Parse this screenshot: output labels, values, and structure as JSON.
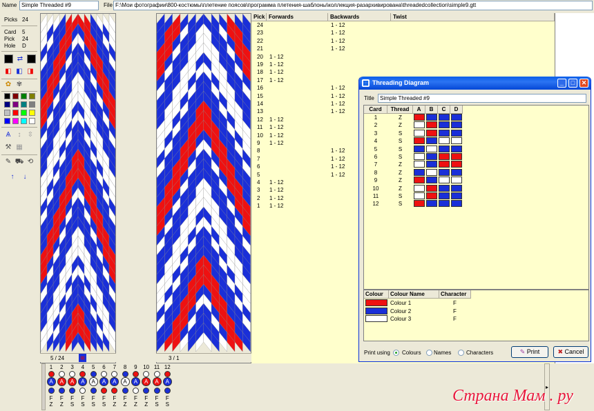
{
  "toolbar": {
    "name_label": "Name",
    "name_value": "Simple Threaded #9",
    "file_label": "File",
    "file_path": "F:\\Мои фотографии\\800-костюмы\\плетение поясов\\программа плетения-шаблоны\\коллекция-разархивирована\\threadedcollection\\simple9.gtt"
  },
  "info": {
    "picks_label": "Picks",
    "picks_value": "24",
    "card_label": "Card",
    "card_value": "5",
    "pick_label": "Pick",
    "pick_value": "24",
    "hole_label": "Hole",
    "hole_value": "D"
  },
  "palette": [
    "#000000",
    "#800000",
    "#008000",
    "#808000",
    "#000080",
    "#800080",
    "#008080",
    "#808080",
    "#C0C0C0",
    "#FF0000",
    "#00FF00",
    "#FFFF00",
    "#0000FF",
    "#FF00FF",
    "#00FFFF",
    "#FFFFFF"
  ],
  "colors": {
    "red": "#EE1111",
    "blue": "#1A2FD8",
    "white": "#FFFFFF",
    "pale_yellow": "#FFFFCC"
  },
  "status": {
    "left_counter": "5 / 24",
    "right_counter": "3 / 1"
  },
  "pick_table": {
    "headers": {
      "pick": "Pick",
      "forwards": "Forwards",
      "backwards": "Backwards",
      "twist": "Twist"
    },
    "rows": [
      {
        "pick": "24",
        "f": "",
        "b": "1 - 12"
      },
      {
        "pick": "23",
        "f": "",
        "b": "1 - 12"
      },
      {
        "pick": "22",
        "f": "",
        "b": "1 - 12"
      },
      {
        "pick": "21",
        "f": "",
        "b": "1 - 12"
      },
      {
        "pick": "20",
        "f": "1 - 12",
        "b": ""
      },
      {
        "pick": "19",
        "f": "1 - 12",
        "b": ""
      },
      {
        "pick": "18",
        "f": "1 - 12",
        "b": ""
      },
      {
        "pick": "17",
        "f": "1 - 12",
        "b": ""
      },
      {
        "pick": "16",
        "f": "",
        "b": "1 - 12"
      },
      {
        "pick": "15",
        "f": "",
        "b": "1 - 12"
      },
      {
        "pick": "14",
        "f": "",
        "b": "1 - 12"
      },
      {
        "pick": "13",
        "f": "",
        "b": "1 - 12"
      },
      {
        "pick": "12",
        "f": "1 - 12",
        "b": ""
      },
      {
        "pick": "11",
        "f": "1 - 12",
        "b": ""
      },
      {
        "pick": "10",
        "f": "1 - 12",
        "b": ""
      },
      {
        "pick": "9",
        "f": "1 - 12",
        "b": ""
      },
      {
        "pick": "8",
        "f": "",
        "b": "1 - 12"
      },
      {
        "pick": "7",
        "f": "",
        "b": "1 - 12"
      },
      {
        "pick": "6",
        "f": "",
        "b": "1 - 12"
      },
      {
        "pick": "5",
        "f": "",
        "b": "1 - 12"
      },
      {
        "pick": "4",
        "f": "1 - 12",
        "b": ""
      },
      {
        "pick": "3",
        "f": "1 - 12",
        "b": ""
      },
      {
        "pick": "2",
        "f": "1 - 12",
        "b": ""
      },
      {
        "pick": "1",
        "f": "1 - 12",
        "b": ""
      }
    ]
  },
  "dialog": {
    "title": "Threading Diagram",
    "title_label": "Title",
    "title_value": "Simple Threaded #9",
    "headers": {
      "card": "Card",
      "thread": "Thread",
      "a": "A",
      "b": "B",
      "c": "C",
      "d": "D"
    },
    "cards": [
      {
        "card": "1",
        "thread": "Z",
        "holes": [
          "R",
          "B",
          "B",
          "B"
        ]
      },
      {
        "card": "2",
        "thread": "Z",
        "holes": [
          "W",
          "R",
          "B",
          "B"
        ]
      },
      {
        "card": "3",
        "thread": "S",
        "holes": [
          "W",
          "R",
          "B",
          "B"
        ]
      },
      {
        "card": "4",
        "thread": "S",
        "holes": [
          "R",
          "B",
          "W",
          "W"
        ]
      },
      {
        "card": "5",
        "thread": "S",
        "holes": [
          "B",
          "W",
          "B",
          "B"
        ]
      },
      {
        "card": "6",
        "thread": "S",
        "holes": [
          "W",
          "B",
          "R",
          "R"
        ]
      },
      {
        "card": "7",
        "thread": "Z",
        "holes": [
          "W",
          "B",
          "R",
          "R"
        ]
      },
      {
        "card": "8",
        "thread": "Z",
        "holes": [
          "B",
          "W",
          "B",
          "B"
        ]
      },
      {
        "card": "9",
        "thread": "Z",
        "holes": [
          "R",
          "B",
          "W",
          "W"
        ]
      },
      {
        "card": "10",
        "thread": "Z",
        "holes": [
          "W",
          "R",
          "B",
          "B"
        ]
      },
      {
        "card": "11",
        "thread": "S",
        "holes": [
          "W",
          "R",
          "B",
          "B"
        ]
      },
      {
        "card": "12",
        "thread": "S",
        "holes": [
          "R",
          "B",
          "B",
          "B"
        ]
      }
    ],
    "legend_headers": {
      "colour": "Colour",
      "name": "Colour Name",
      "character": "Character"
    },
    "legend": [
      {
        "name": "Colour 1",
        "char": "F",
        "color": "#EE1111"
      },
      {
        "name": "Colour 2",
        "char": "F",
        "color": "#1A2FD8"
      },
      {
        "name": "Colour 3",
        "char": "F",
        "color": "#FFFFFF"
      }
    ],
    "print_using": "Print using",
    "options": [
      "Colours",
      "Names",
      "Characters"
    ],
    "selected_option": "Colours",
    "print_button": "Print",
    "cancel_button": "Cancel"
  },
  "bottom": {
    "card_numbers": [
      "1",
      "2",
      "3",
      "4",
      "5",
      "6",
      "7",
      "8",
      "9",
      "10",
      "11",
      "12"
    ],
    "center_letters": [
      "A",
      "A",
      "A",
      "A",
      "A",
      "A",
      "A",
      "A",
      "A",
      "A",
      "A",
      "A"
    ],
    "f_row": [
      "F",
      "F",
      "F",
      "F",
      "F",
      "F",
      "F",
      "F",
      "F",
      "F",
      "F",
      "F"
    ],
    "twist_row": [
      "Z",
      "Z",
      "S",
      "S",
      "S",
      "S",
      "Z",
      "Z",
      "Z",
      "Z",
      "S",
      "S"
    ]
  },
  "watermark": "Страна Мам . ру"
}
